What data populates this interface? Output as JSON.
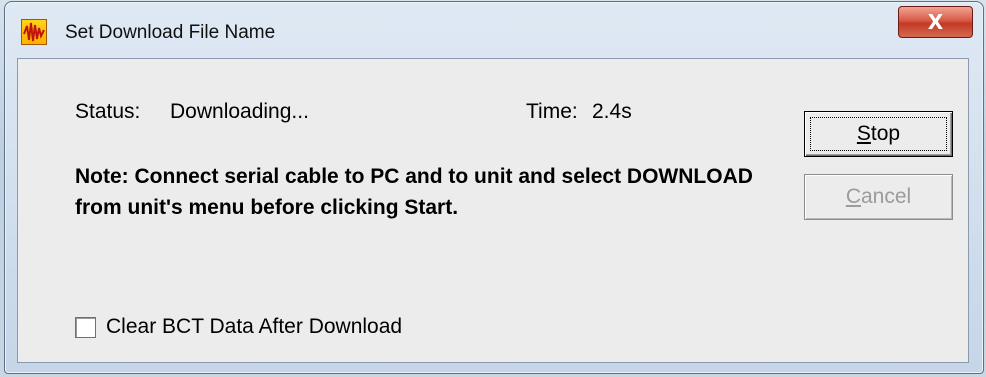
{
  "window": {
    "title": "Set Download File Name",
    "close_glyph": "X",
    "icon": "seismograph-app-icon"
  },
  "status": {
    "label": "Status:",
    "value": "Downloading...",
    "time_label": "Time:",
    "time_value": "2.4s"
  },
  "note": {
    "text": "Note:  Connect serial cable to PC and to unit and select DOWNLOAD from unit's menu before clicking Start."
  },
  "buttons": {
    "stop": {
      "accel": "S",
      "rest": "top"
    },
    "cancel": {
      "accel": "C",
      "rest": "ancel"
    }
  },
  "options": {
    "clear_bct_label": "Clear BCT Data After Download",
    "clear_bct_checked": false
  },
  "colors": {
    "close_button": "#c23a25",
    "disabled_text": "#9b9b9b",
    "client_background": "#ececec"
  }
}
